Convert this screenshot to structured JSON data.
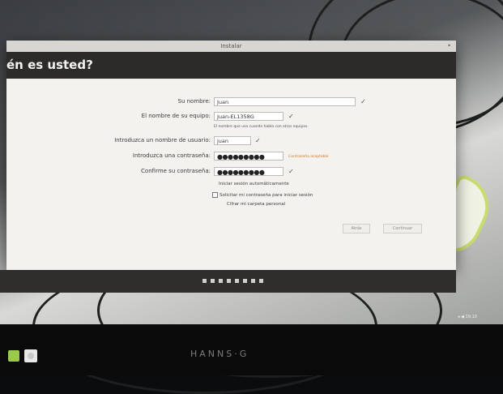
{
  "window": {
    "title": "Instalar",
    "header": "én es usted?"
  },
  "form": {
    "name": {
      "label": "Su nombre:",
      "value": "Juan"
    },
    "computer": {
      "label": "El nombre de su equipo:",
      "value": "Juan-EL1358G",
      "hint": "El nombre que usa cuando habla con otros equipos."
    },
    "username": {
      "label": "Introduzca un nombre de usuario:",
      "value": "juan"
    },
    "password": {
      "label": "Introduzca una contraseña:",
      "value": "●●●●●●●●●",
      "strength": "Contraseña aceptable"
    },
    "confirm": {
      "label": "Confirme su contraseña:",
      "value": "●●●●●●●●●"
    },
    "options": [
      "Iniciar sesión automáticamente",
      "Solicitar mi contraseña para iniciar sesión",
      "Cifrar mi carpeta personal"
    ]
  },
  "buttons": {
    "back": "Atrás",
    "continue": "Continuar"
  },
  "monitor": {
    "brand": "HANNS·G"
  },
  "tray": {
    "time": "◂ ◀ 19:10"
  }
}
